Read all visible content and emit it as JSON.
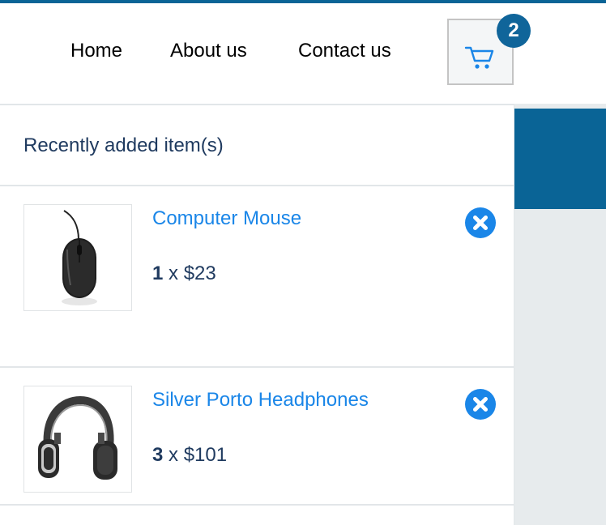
{
  "nav": {
    "links": [
      {
        "label": "Home"
      },
      {
        "label": "About us"
      },
      {
        "label": "Contact us"
      }
    ],
    "cart": {
      "count": "2",
      "icon": "cart-icon"
    }
  },
  "dropdown": {
    "title": "Recently added item(s)",
    "items": [
      {
        "name": "Computer Mouse",
        "quantity": "1",
        "sep": " x ",
        "price": "$23",
        "image": "mouse-image",
        "remove_icon": "close-circle-icon"
      },
      {
        "name": "Silver Porto Headphones",
        "quantity": "3",
        "sep": " x ",
        "price": "$101",
        "image": "headphones-image",
        "remove_icon": "close-circle-icon"
      }
    ]
  },
  "colors": {
    "accent": "#1a86e8",
    "brand": "#0a6496",
    "text": "#1f3a5f"
  }
}
